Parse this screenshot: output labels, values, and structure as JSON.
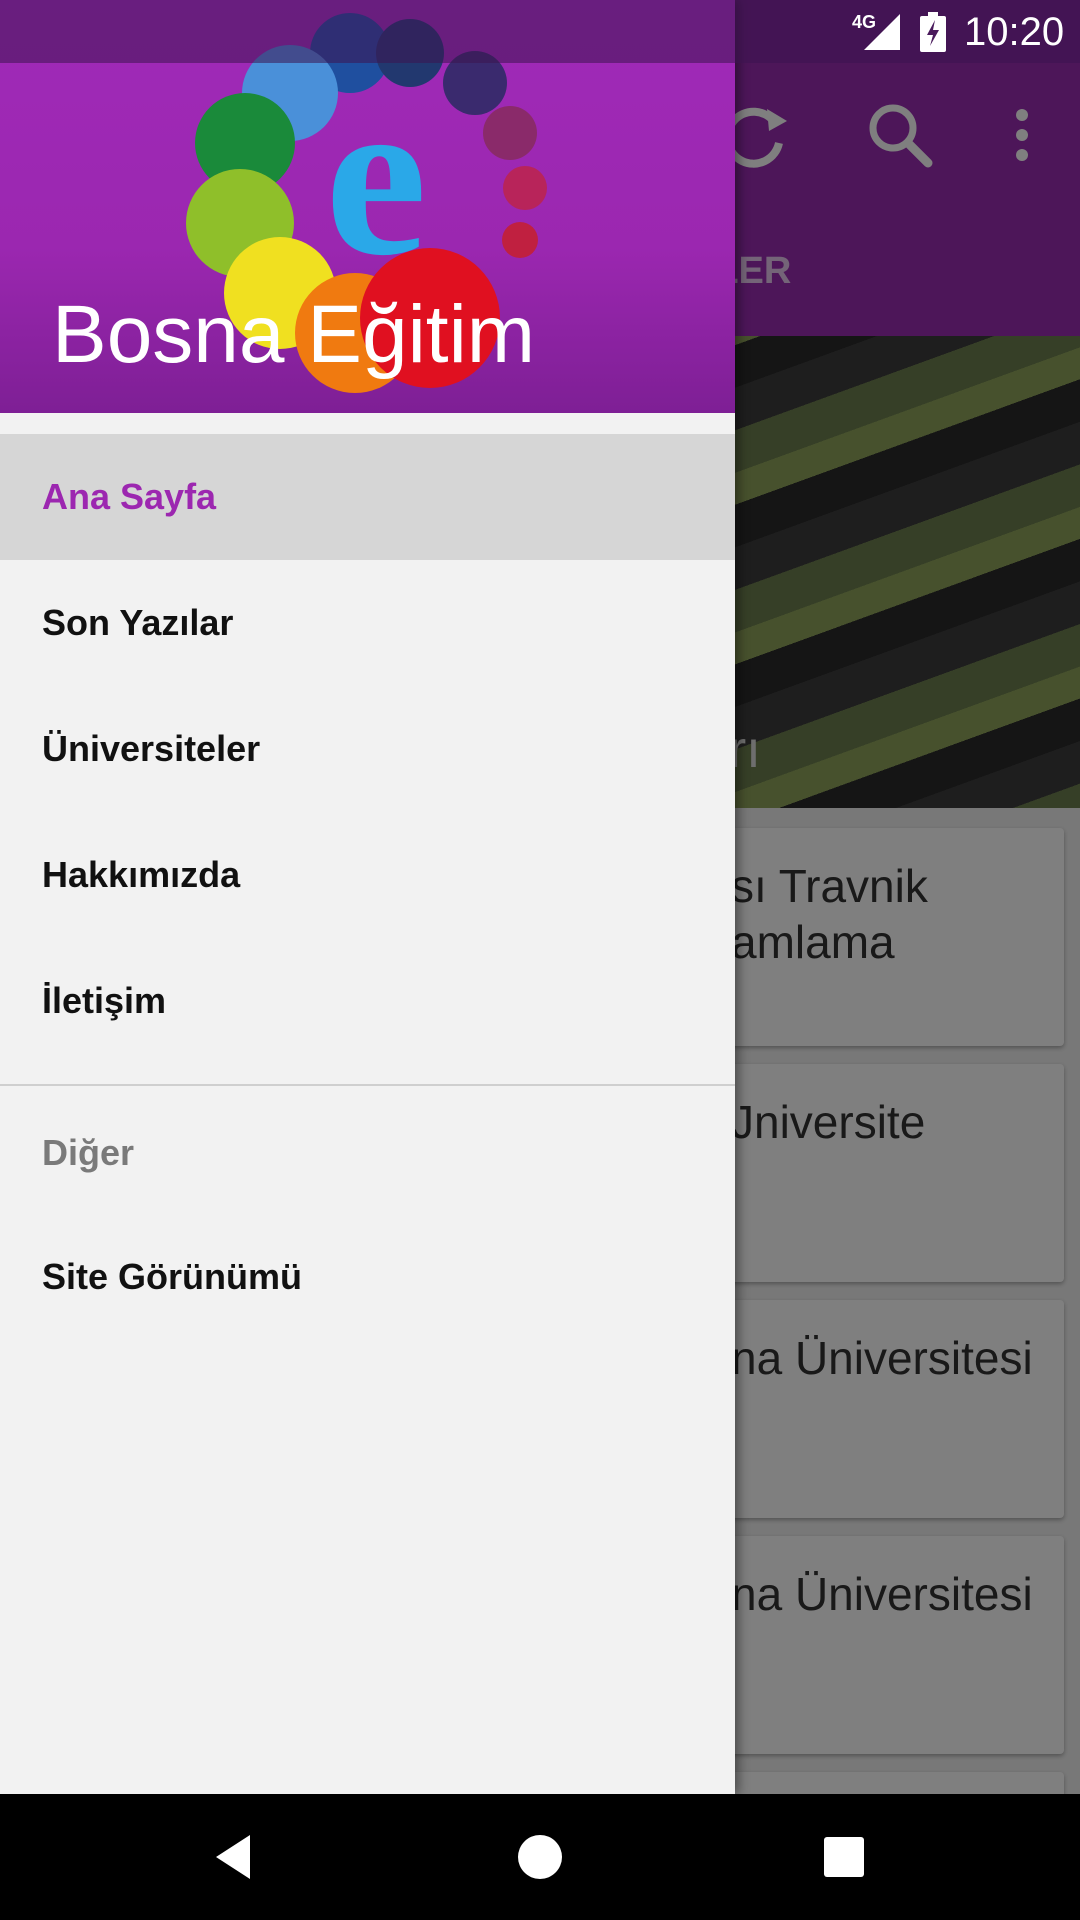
{
  "status_bar": {
    "network": "4G",
    "time": "10:20"
  },
  "background_app": {
    "tabs_partial": "ELER",
    "hero_caption_partial": "arı",
    "cards": [
      {
        "title_partial": "sı Travnik\namlama"
      },
      {
        "title_partial": "Jniversite"
      },
      {
        "title_partial": "na Üniversitesi"
      },
      {
        "title_partial": "na Üniversitesi"
      }
    ],
    "icons": [
      "refresh-icon",
      "search-icon",
      "more-vert-icon"
    ]
  },
  "drawer": {
    "header_title": "Bosna Eğitim",
    "logo_letter": "e",
    "menu": [
      {
        "label": "Ana Sayfa",
        "active": true
      },
      {
        "label": "Son Yazılar",
        "active": false
      },
      {
        "label": "Üniversiteler",
        "active": false
      },
      {
        "label": "Hakkımızda",
        "active": false
      },
      {
        "label": "İletişim",
        "active": false
      }
    ],
    "section_header": "Diğer",
    "other_menu": [
      {
        "label": "Site Görünümü"
      }
    ]
  },
  "nav_bar": {
    "buttons": [
      "back-icon",
      "home-icon",
      "recents-icon"
    ]
  },
  "colors": {
    "primary": "#9c27b0",
    "drawer_bg": "#f2f2f2",
    "active_item_bg": "#d6d6d6",
    "status_bar": "#6a1b80"
  }
}
